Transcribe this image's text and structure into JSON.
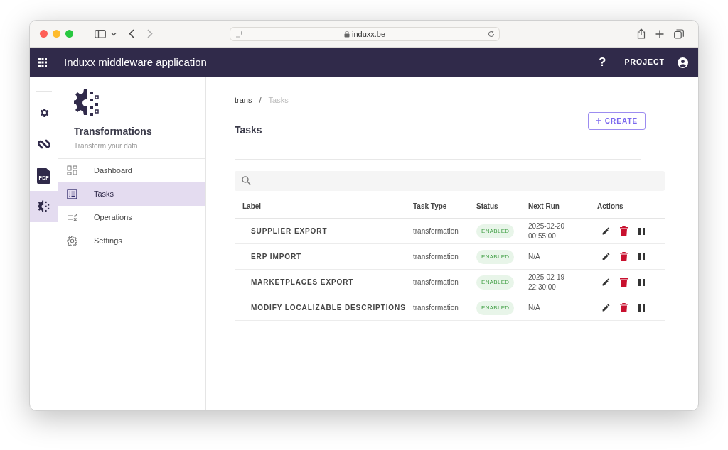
{
  "browser": {
    "url": "induxx.be"
  },
  "app_bar": {
    "title": "Induxx middleware application",
    "help": "?",
    "project": "PROJECT"
  },
  "rail": [
    {
      "kind": "gear",
      "selected": false
    },
    {
      "kind": "link",
      "selected": false
    },
    {
      "kind": "pdf",
      "label": "PDF",
      "selected": false
    },
    {
      "kind": "transform",
      "selected": true
    }
  ],
  "sidebar": {
    "title": "Transformations",
    "subtitle": "Transform your data",
    "items": [
      {
        "label": "Dashboard",
        "kind": "dashboard",
        "selected": false
      },
      {
        "label": "Tasks",
        "kind": "tasks",
        "selected": true
      },
      {
        "label": "Operations",
        "kind": "operations",
        "selected": false
      },
      {
        "label": "Settings",
        "kind": "settings",
        "selected": false
      }
    ]
  },
  "breadcrumb": [
    "trans",
    "Tasks"
  ],
  "breadcrumb_separator": "/",
  "page_title": "Tasks",
  "create_button": "CREATE",
  "table": {
    "columns": [
      "Label",
      "Task Type",
      "Status",
      "Next Run",
      "Actions"
    ],
    "rows": [
      {
        "label": "SUPPLIER EXPORT",
        "task_type": "transformation",
        "status": "ENABLED",
        "enabled": true,
        "next_run": "2025-02-20 00:55:00"
      },
      {
        "label": "ERP IMPORT",
        "task_type": "transformation",
        "status": "ENABLED",
        "enabled": true,
        "next_run": "N/A"
      },
      {
        "label": "MARKETPLACES EXPORT",
        "task_type": "transformation",
        "status": "ENABLED",
        "enabled": true,
        "next_run": "2025-02-19 22:30:00"
      },
      {
        "label": "MODIFY LOCALIZABLE DESCRIPTIONS",
        "task_type": "transformation",
        "status": "ENABLED",
        "enabled": true,
        "next_run": "N/A"
      }
    ]
  }
}
